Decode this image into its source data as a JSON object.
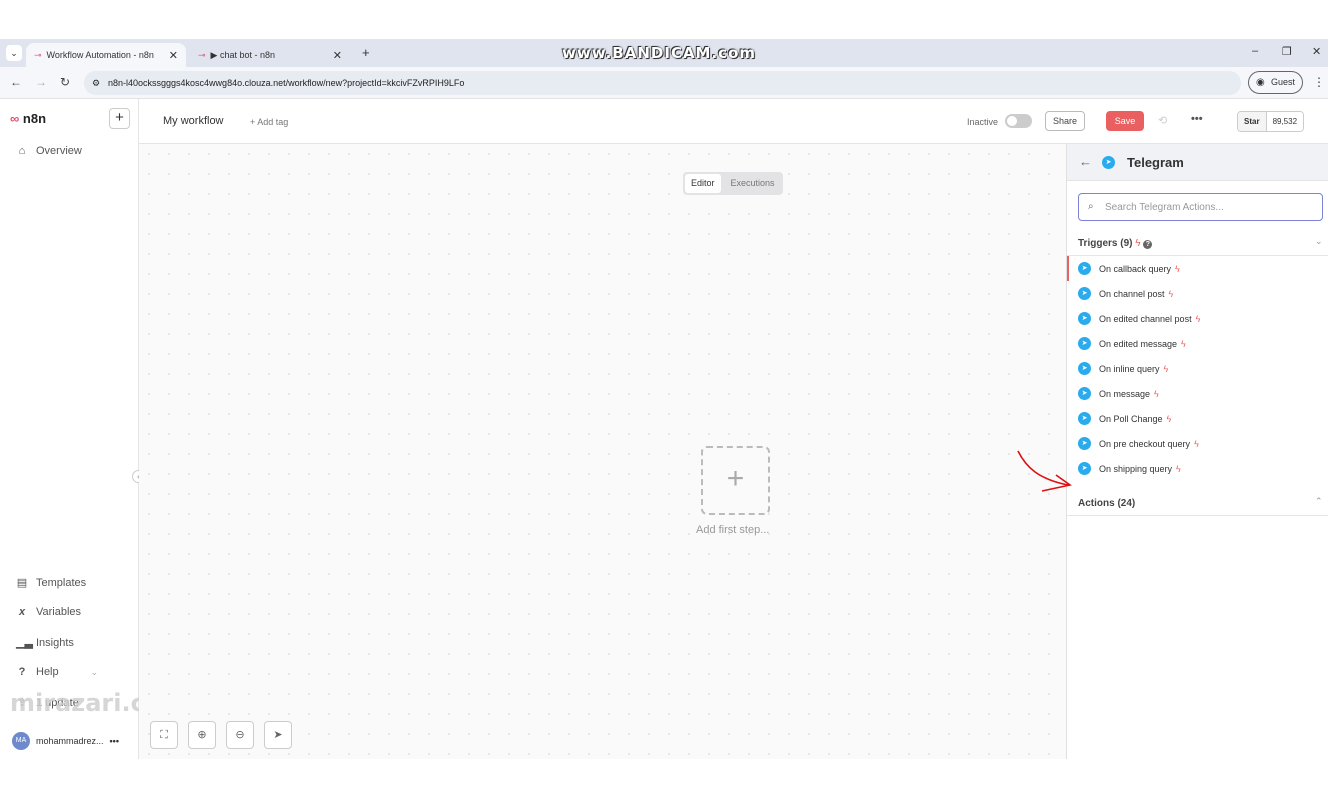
{
  "browser": {
    "tabs": [
      {
        "label": "Workflow Automation - n8n"
      },
      {
        "label": "▶ chat bot - n8n"
      }
    ],
    "watermark": "www.BANDICAM.com",
    "url": "n8n-l40ockssgggs4kosc4wwg84o.clouza.net/workflow/new?projectId=kkcivFZvRPIH9LFo",
    "profile": "Guest"
  },
  "sidebar": {
    "logo": "n8n",
    "top_items": [
      {
        "label": "Overview",
        "icon": "home-icon"
      }
    ],
    "bottom_items": [
      {
        "label": "Templates",
        "icon": "templates-icon"
      },
      {
        "label": "Variables",
        "icon": "variables-icon"
      },
      {
        "label": "Insights",
        "icon": "insights-icon"
      },
      {
        "label": "Help",
        "icon": "help-icon"
      },
      {
        "label": "1 update",
        "icon": "update-icon"
      }
    ],
    "overlay_watermark": "mirazari.com",
    "user": {
      "initials": "MA",
      "name": "mohammadrez..."
    }
  },
  "header": {
    "workflow_name": "My workflow",
    "add_tag": "+ Add tag",
    "status": "Inactive",
    "share": "Share",
    "save": "Save",
    "github": {
      "star": "Star",
      "count": "89,532"
    }
  },
  "view_tabs": {
    "editor": "Editor",
    "executions": "Executions"
  },
  "canvas": {
    "add_first_step": "Add first step..."
  },
  "panel": {
    "title": "Telegram",
    "search_placeholder": "Search Telegram Actions...",
    "triggers_label": "Triggers (9)",
    "triggers": [
      "On callback query",
      "On channel post",
      "On edited channel post",
      "On edited message",
      "On inline query",
      "On message",
      "On Poll Change",
      "On pre checkout query",
      "On shipping query"
    ],
    "actions_label": "Actions (24)"
  },
  "colors": {
    "accent": "#ea4b71",
    "save": "#ea5f5f",
    "telegram": "#2aabee",
    "search_border": "#7c83d6"
  }
}
